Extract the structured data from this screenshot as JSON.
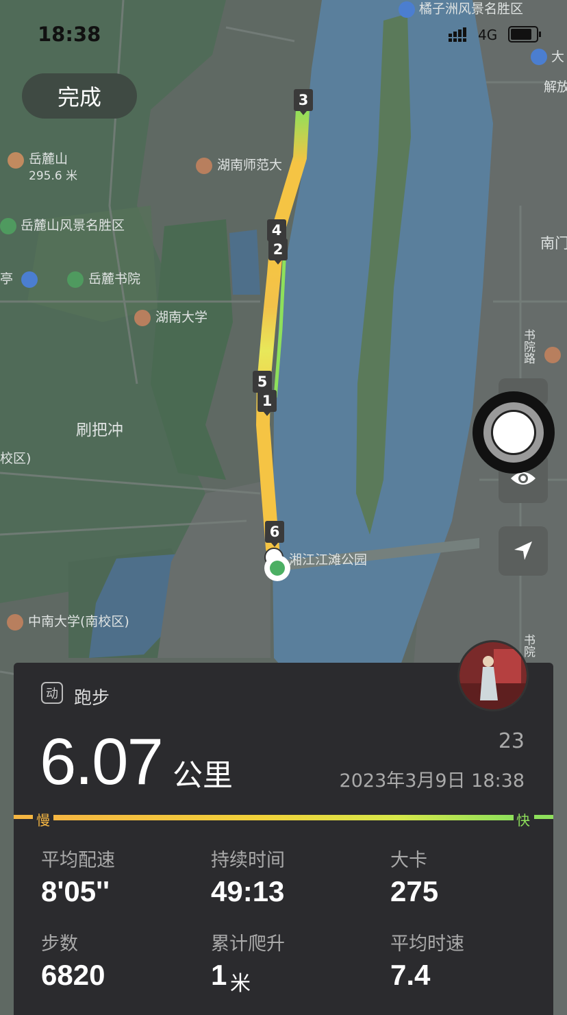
{
  "status_bar": {
    "time": "18:38",
    "network": "4G"
  },
  "done_button": {
    "label": "完成"
  },
  "map": {
    "labels": {
      "yuelushan": "岳麓山",
      "yuelushan_elev": "295.6 米",
      "hunan_normal": "湖南师范大",
      "yuelushan_scenic": "岳麓山风景名胜区",
      "yuelu_academy": "岳麓书院",
      "hunan_univ": "湖南大学",
      "shuabachong": "刷把冲",
      "xiaoqu": "校区)",
      "ting": "亭",
      "central_south": "中南大学(南校区)",
      "juzizhou": "橘子洲风景名胜区",
      "xiangjiang_park": "湘江江滩公园",
      "nanmen": "南门",
      "jiefang": "解放",
      "da": "大",
      "shuyuan_road": "书院路",
      "shuyuan_road2": "书院"
    },
    "km_markers": [
      "3",
      "4",
      "2",
      "5",
      "1",
      "6"
    ]
  },
  "controls": {
    "shutter": "camera-shutter",
    "visibility": "eye-icon",
    "locate": "navigation-arrow-icon"
  },
  "summary": {
    "activity_icon": "动",
    "activity_type": "跑步",
    "distance": "6.07",
    "distance_unit": "公里",
    "count": "23",
    "datetime": "2023年3月9日 18:38",
    "slow_label": "慢",
    "fast_label": "快",
    "stats": {
      "avg_pace_label": "平均配速",
      "avg_pace_value": "8'05''",
      "duration_label": "持续时间",
      "duration_value": "49:13",
      "calories_label": "大卡",
      "calories_value": "275",
      "steps_label": "步数",
      "steps_value": "6820",
      "climb_label": "累计爬升",
      "climb_value": "1",
      "climb_unit": "米",
      "avg_speed_label": "平均时速",
      "avg_speed_value": "7.4"
    }
  },
  "colors": {
    "slow": "#f5b642",
    "fast": "#8ee05b",
    "river": "#5a7f9c",
    "card": "#2b2b2e"
  }
}
